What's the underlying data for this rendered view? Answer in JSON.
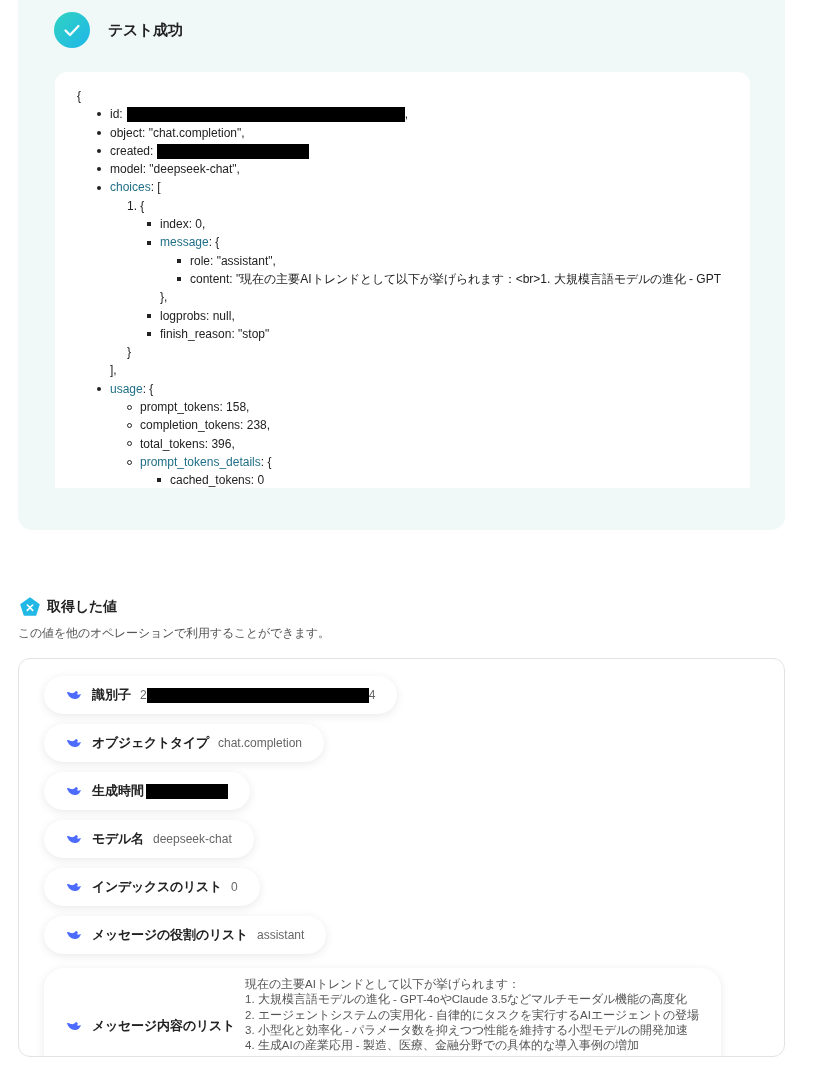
{
  "test_result": {
    "title": "テスト成功",
    "output": {
      "text": "{",
      "children": [
        {
          "kind": "disc",
          "text": "id:",
          "redacted": true,
          "suffix": ","
        },
        {
          "kind": "disc",
          "text": "object: \"chat.completion\","
        },
        {
          "kind": "disc",
          "text": "created:",
          "redacted": true
        },
        {
          "kind": "disc",
          "text": "model: \"deepseek-chat\","
        },
        {
          "kind": "disc",
          "key": "choices",
          "text": ": [",
          "children": [
            {
              "text": "1. {",
              "children": [
                {
                  "kind": "square",
                  "text": "index: 0,"
                },
                {
                  "kind": "square",
                  "key": "message",
                  "text": ": {",
                  "children": [
                    {
                      "kind": "square",
                      "text": "role: \"assistant\","
                    },
                    {
                      "kind": "square",
                      "text": "content: \"現在の主要AIトレンドとして以下が挙げられます：<br>1. 大規模言語モデルの進化 - GPT"
                    }
                  ],
                  "close": "},"
                },
                {
                  "kind": "square",
                  "text": "logprobs: null,"
                },
                {
                  "kind": "square",
                  "text": "finish_reason: \"stop\""
                }
              ],
              "close": "}"
            }
          ],
          "close": "],"
        },
        {
          "kind": "disc",
          "key": "usage",
          "text": ": {",
          "children": [
            {
              "kind": "circle",
              "text": "prompt_tokens: 158,"
            },
            {
              "kind": "circle",
              "text": "completion_tokens: 238,"
            },
            {
              "kind": "circle",
              "text": "total_tokens: 396,"
            },
            {
              "kind": "circle",
              "key": "prompt_tokens_details",
              "text": ": {",
              "children": [
                {
                  "kind": "square",
                  "text": "cached_tokens: 0"
                }
              ]
            }
          ]
        }
      ]
    }
  },
  "values_section": {
    "title": "取得した値",
    "description": "この値を他のオペレーションで利用することができます。",
    "values": [
      {
        "label": "識別子",
        "value": "2",
        "redacted": true,
        "suffix": "4"
      },
      {
        "label": "オブジェクトタイプ",
        "value": "chat.completion"
      },
      {
        "label": "生成時間",
        "redacted": true
      },
      {
        "label": "モデル名",
        "value": "deepseek-chat"
      },
      {
        "label": "インデックスのリスト",
        "value": "0"
      },
      {
        "label": "メッセージの役割のリスト",
        "value": "assistant"
      },
      {
        "label": "メッセージ内容のリスト",
        "lines": [
          "現在の主要AIトレンドとして以下が挙げられます：",
          "1. 大規模言語モデルの進化 - GPT-4oやClaude 3.5などマルチモーダル機能の高度化",
          "2. エージェントシステムの実用化 - 自律的にタスクを実行するAIエージェントの登場",
          "3. 小型化と効率化 - パラメータ数を抑えつつ性能を維持する小型モデルの開発加速",
          "4. 生成AIの産業応用 - 製造、医療、金融分野での具体的な導入事例の増加"
        ]
      }
    ]
  }
}
